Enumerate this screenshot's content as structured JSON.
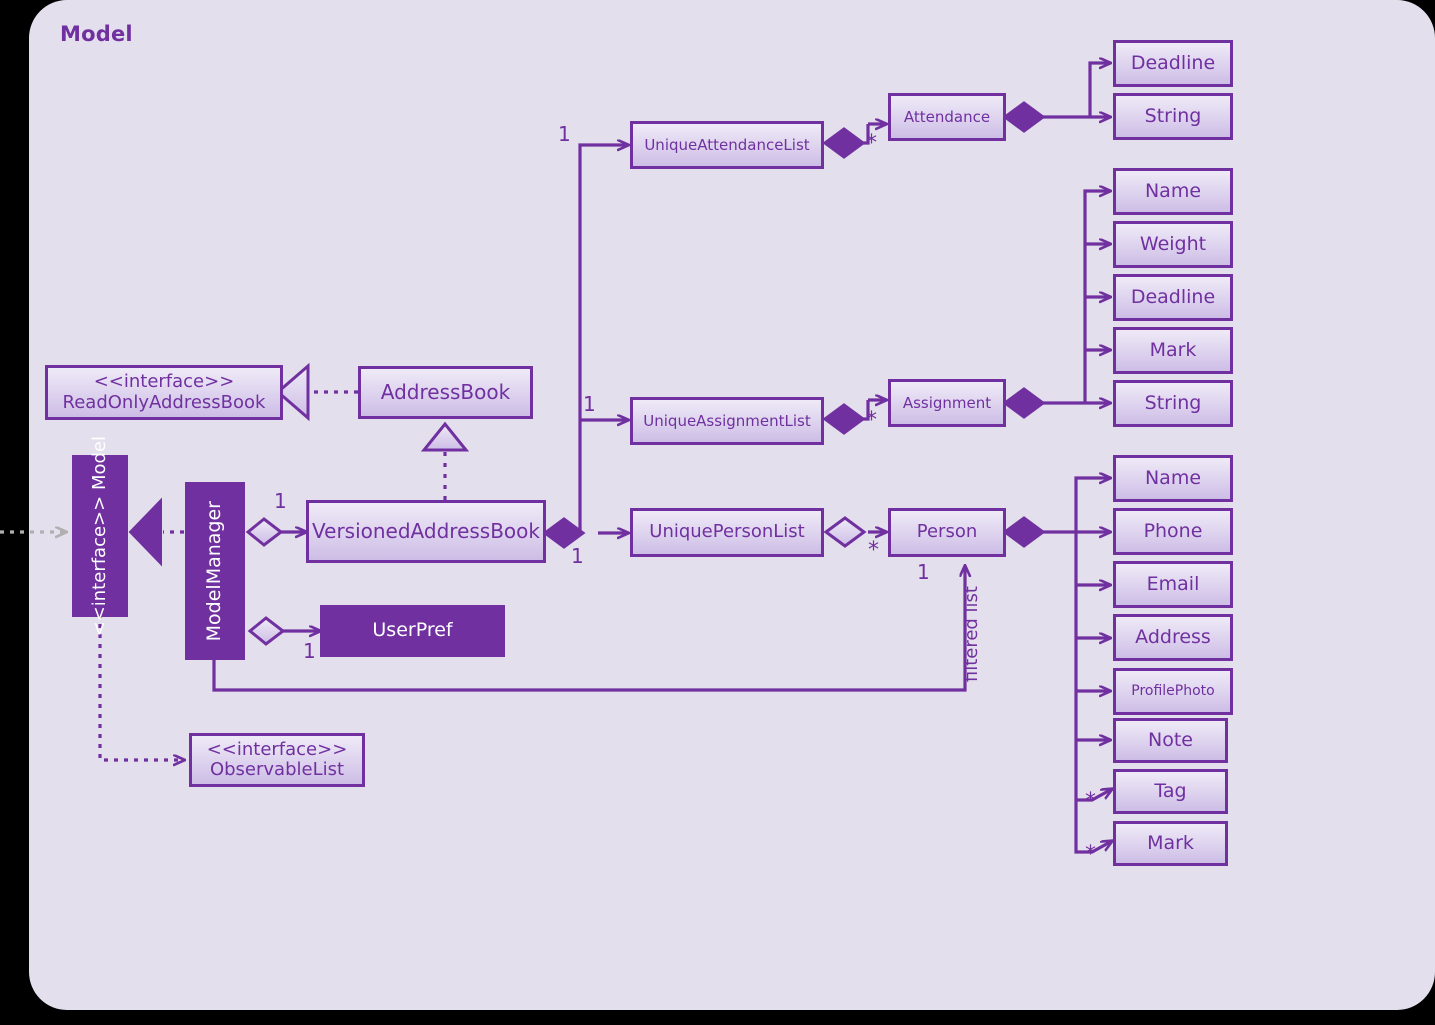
{
  "frame": {
    "title": "Model",
    "accent": "#7030a0",
    "background": "#e4dfec",
    "outside": "#000000"
  },
  "nodes": {
    "read_only_address_book": {
      "stereotype": "<<interface>>",
      "name": "ReadOnlyAddressBook"
    },
    "model": {
      "stereotype": "<<interface>>",
      "name": "Model"
    },
    "observable_list": {
      "stereotype": "<<interface>>",
      "name": "ObservableList"
    },
    "address_book": {
      "name": "AddressBook"
    },
    "versioned_address_book": {
      "name": "VersionedAddressBook"
    },
    "model_manager": {
      "name": "ModelManager"
    },
    "user_pref": {
      "name": "UserPref"
    },
    "unique_attendance_list": {
      "name": "UniqueAttendanceList"
    },
    "unique_assignment_list": {
      "name": "UniqueAssignmentList"
    },
    "unique_person_list": {
      "name": "UniquePersonList"
    },
    "attendance": {
      "name": "Attendance"
    },
    "assignment": {
      "name": "Assignment"
    },
    "person": {
      "name": "Person"
    },
    "attendance_attrs": [
      {
        "name": "Deadline"
      },
      {
        "name": "String"
      }
    ],
    "assignment_attrs": [
      {
        "name": "Name"
      },
      {
        "name": "Weight"
      },
      {
        "name": "Deadline"
      },
      {
        "name": "Mark"
      },
      {
        "name": "String"
      }
    ],
    "person_attrs": [
      {
        "name": "Name"
      },
      {
        "name": "Phone"
      },
      {
        "name": "Email"
      },
      {
        "name": "Address"
      },
      {
        "name": "ProfilePhoto"
      },
      {
        "name": "Note"
      },
      {
        "name": "Tag"
      },
      {
        "name": "Mark"
      }
    ]
  },
  "multiplicities": {
    "attendance_list_one": "1",
    "attendance_star": "*",
    "assignment_list_one": "1",
    "assignment_star": "*",
    "person_list_one": "1",
    "person_star": "*",
    "versioned_one": "1",
    "userpref_one": "1",
    "person_filtered_one": "1",
    "tag_star": "*",
    "mark_star": "*"
  },
  "labels": {
    "filtered_list": "filtered list"
  }
}
